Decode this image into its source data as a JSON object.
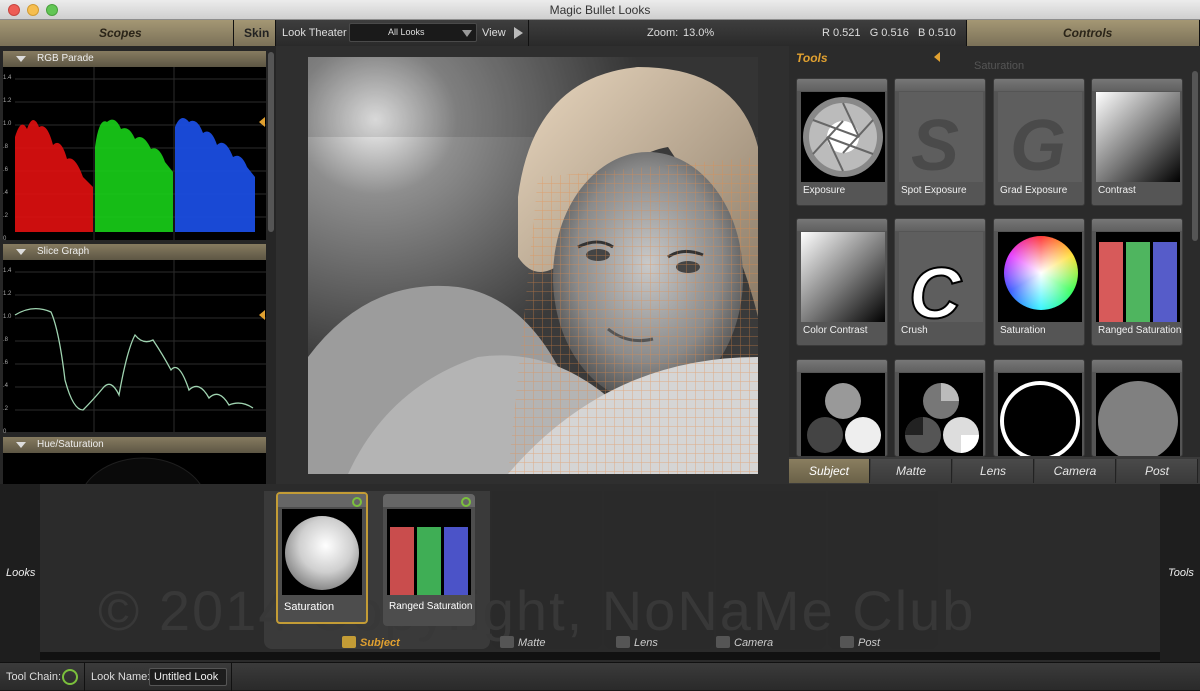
{
  "window": {
    "title": "Magic Bullet Looks"
  },
  "header": {
    "scopes": "Scopes",
    "skin": "Skin",
    "look_theater": "Look Theater",
    "look_select": "All Looks",
    "view": "View",
    "zoom_label": "Zoom:",
    "zoom_value": "13.0%",
    "rgb_readout": "R 0.521   G 0.516   B 0.510",
    "controls": "Controls"
  },
  "scopes": {
    "rgb_parade": "RGB Parade",
    "slice_graph": "Slice Graph",
    "hue_saturation": "Hue/Saturation",
    "axis_ticks": [
      "1.4",
      "1.2",
      "1.0",
      ".8",
      ".6",
      ".4",
      ".2",
      "0"
    ]
  },
  "tools": {
    "header": "Tools",
    "ghost_text": "Saturation",
    "items": [
      {
        "label": "Exposure",
        "icon": "aperture-icon"
      },
      {
        "label": "Spot Exposure",
        "icon": "s-letter-icon",
        "glyph": "S"
      },
      {
        "label": "Grad Exposure",
        "icon": "g-letter-icon",
        "glyph": "G"
      },
      {
        "label": "Contrast",
        "icon": "gradient-icon"
      },
      {
        "label": "Color Contrast",
        "icon": "gradient-icon"
      },
      {
        "label": "Crush",
        "icon": "c-letter-icon",
        "glyph": "C"
      },
      {
        "label": "Saturation",
        "icon": "color-wheel-icon"
      },
      {
        "label": "Ranged Saturation",
        "icon": "rgb-bars-icon"
      },
      {
        "label": "",
        "icon": "three-circles-icon"
      },
      {
        "label": "",
        "icon": "pie-circles-icon"
      },
      {
        "label": "",
        "icon": "ring-icon"
      },
      {
        "label": "",
        "icon": "gray-disc-icon"
      }
    ],
    "tabs": [
      "Subject",
      "Matte",
      "Lens",
      "Camera",
      "Post"
    ]
  },
  "chain": {
    "looks_label": "Looks",
    "tools_label": "Tools",
    "watermark": "© 2014 Copyright, NoNaMe Club",
    "tiles": [
      {
        "label": "Saturation"
      },
      {
        "label": "Ranged Saturation"
      }
    ],
    "segments": [
      "Subject",
      "Matte",
      "Lens",
      "Camera",
      "Post"
    ]
  },
  "status": {
    "tool_chain": "Tool Chain:",
    "look_name_label": "Look Name:",
    "look_name_value": "Untitled Look"
  },
  "colors": {
    "accent": "#e0a030",
    "power": "#7bc03c",
    "gold_header": "#8e8366"
  }
}
